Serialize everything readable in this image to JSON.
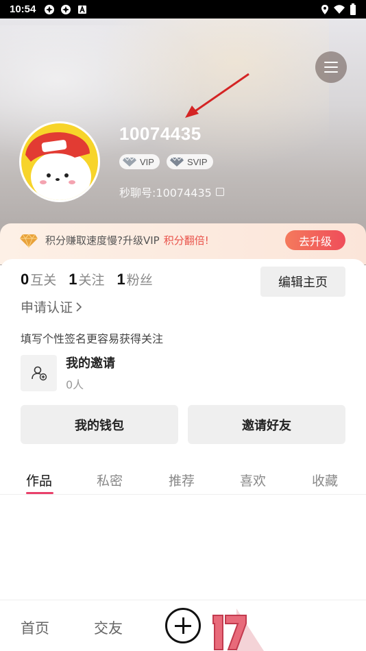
{
  "status_bar": {
    "time": "10:54"
  },
  "profile": {
    "user_id": "10074435",
    "badges": [
      {
        "label": "VIP"
      },
      {
        "label": "SVIP"
      }
    ],
    "chat_id": "秒聊号:10074435"
  },
  "vip_banner": {
    "text": "积分赚取速度慢?升级VIP",
    "highlight": "积分翻倍!",
    "button": "去升级"
  },
  "stats": [
    {
      "num": "0",
      "label": "互关"
    },
    {
      "num": "1",
      "label": "关注"
    },
    {
      "num": "1",
      "label": "粉丝"
    }
  ],
  "edit_button": "编辑主页",
  "certification": "申请认证",
  "signature": "填写个性签名更容易获得关注",
  "invite": {
    "title": "我的邀请",
    "count": "0人"
  },
  "actions": {
    "wallet": "我的钱包",
    "invite_friends": "邀请好友"
  },
  "tabs": [
    {
      "label": "作品"
    },
    {
      "label": "私密"
    },
    {
      "label": "推荐"
    },
    {
      "label": "喜欢"
    },
    {
      "label": "收藏"
    }
  ],
  "bottom_nav": {
    "home": "首页",
    "friends": "交友"
  },
  "colors": {
    "accent": "#e9406a",
    "upgrade": "#ef4d5a",
    "arrow": "#d42424"
  }
}
